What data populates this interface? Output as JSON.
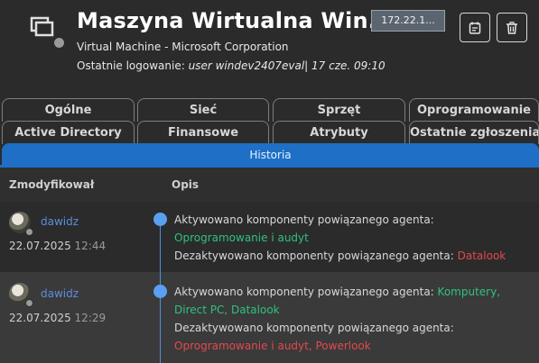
{
  "header": {
    "title": "Maszyna Wirtualna Win...",
    "subtitle": "Virtual Machine - Microsoft Corporation",
    "last_login_label": "Ostatnie logowanie:",
    "last_login_user": "user windev2407eval",
    "last_login_date": "| 17 cze. 09:10",
    "ip": "172.22.1...",
    "status_color": "#9a9a9a"
  },
  "tabs": {
    "row1": [
      "Ogólne",
      "Sieć",
      "Sprzęt",
      "Oprogramowanie"
    ],
    "row2": [
      "Active Directory",
      "Finansowe",
      "Atrybuty",
      "Ostatnie zgłoszenia"
    ],
    "active": "Historia"
  },
  "table": {
    "col_modified": "Zmodyfikował",
    "col_desc": "Opis",
    "rows": [
      {
        "user": "dawidz",
        "date": "22.07.2025",
        "time": "12:44",
        "line1": "Aktywowano komponenty powiązanego agenta:",
        "line1_items": "",
        "line2": "Oprogramowanie i audyt",
        "line3": "Dezaktywowano komponenty powiązanego agenta:",
        "line3_items": "Datalook"
      },
      {
        "user": "dawidz",
        "date": "22.07.2025",
        "time": "12:29",
        "line1": "Aktywowano komponenty powiązanego agenta:",
        "line1_items": "Komputery,",
        "line2": "Direct PC, Datalook",
        "line3": "Dezaktywowano komponenty powiązanego agenta:",
        "line4": "Oprogramowanie i audyt, Powerlook"
      }
    ]
  },
  "colors": {
    "accent": "#1e6fc5",
    "activated": "#2ec27e",
    "deactivated": "#e5484d",
    "user_link": "#5b8fe0"
  }
}
